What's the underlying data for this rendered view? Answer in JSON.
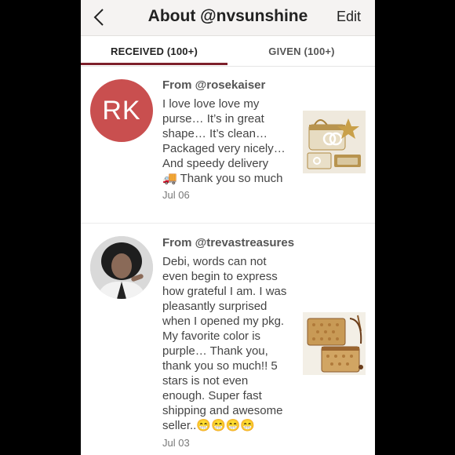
{
  "header": {
    "back_icon": "chevron-left-icon",
    "title": "About @nvsunshine",
    "edit_label": "Edit"
  },
  "tabs": [
    {
      "label": "RECEIVED (100+)",
      "active": true
    },
    {
      "label": "GIVEN (100+)",
      "active": false
    }
  ],
  "reviews": [
    {
      "avatar_initials": "RK",
      "avatar_color": "#c94f4f",
      "from": "From @rosekaiser",
      "lines": [
        "I love love love my",
        "purse… It’s in great",
        "shape… It’s clean…",
        "Packaged very nicely…",
        "And speedy delivery",
        "🚚 Thank you so much"
      ],
      "date": "Jul 06",
      "thumbnail": "handbag-set-photo"
    },
    {
      "avatar_initials": "",
      "from": "From @trevastreasures",
      "lines": [
        "Debi, words can not",
        "even begin to express",
        "how grateful I am. I was",
        "pleasantly surprised",
        "when I opened my pkg.",
        "My favorite color is",
        "purple… Thank you,",
        "thank you so much!! 5",
        "stars is not even",
        "enough. Super fast",
        "shipping and awesome",
        "seller..😁😁😁😁"
      ],
      "date": "Jul 03",
      "thumbnail": "crossbody-bags-photo"
    }
  ],
  "colors": {
    "accent": "#7d1f2b",
    "header_bg": "#f5f3f2"
  }
}
